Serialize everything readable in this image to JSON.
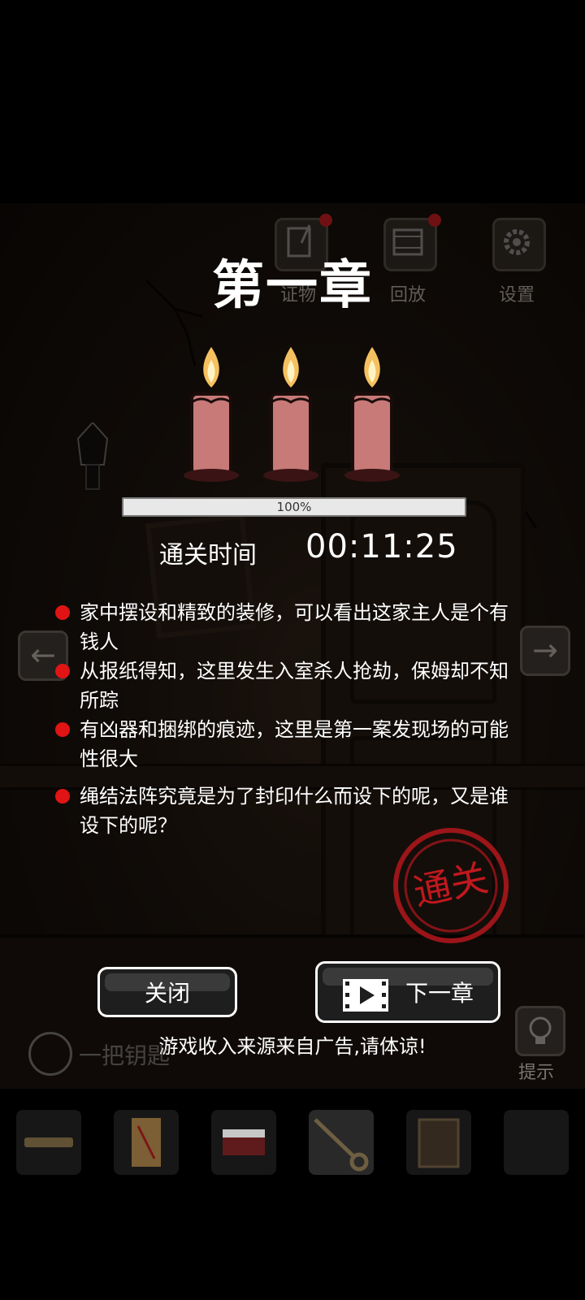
{
  "top_bar": {
    "evidence_label": "证物",
    "replay_label": "回放",
    "settings_label": "设置"
  },
  "result": {
    "chapter_title": "第一章",
    "progress_percent": 100,
    "progress_text": "100%",
    "time_label": "通关时间",
    "time_value": "00:11:25",
    "stamp_text": "通关"
  },
  "clues": [
    {
      "text": "家中摆设和精致的装修，可以看出这家主人是个有钱人"
    },
    {
      "text": "从报纸得知，这里发生入室杀人抢劫，保姆却不知所踪"
    },
    {
      "text": "有凶器和捆绑的痕迹，这里是第一案发现场的可能性很大"
    },
    {
      "text": "绳结法阵究竟是为了封印什么而设下的呢，又是谁设下的呢？"
    }
  ],
  "buttons": {
    "close_label": "关闭",
    "next_label": "下一章"
  },
  "ad_note": "游戏收入来源来自广告,请体谅!",
  "bottom": {
    "item_name": "一把钥匙",
    "hint_label": "提示"
  },
  "colors": {
    "bullet": "#e01414",
    "stamp": "#c0181e",
    "candle": "#c77a78",
    "flame": "#f5c160"
  },
  "icons": {
    "evidence": "notebook-icon",
    "replay": "film-icon",
    "settings": "gear-icon",
    "left": "arrow-left-icon",
    "right": "arrow-right-icon",
    "search": "magnifier-icon",
    "hint": "lightbulb-icon",
    "video": "video-play-icon"
  }
}
